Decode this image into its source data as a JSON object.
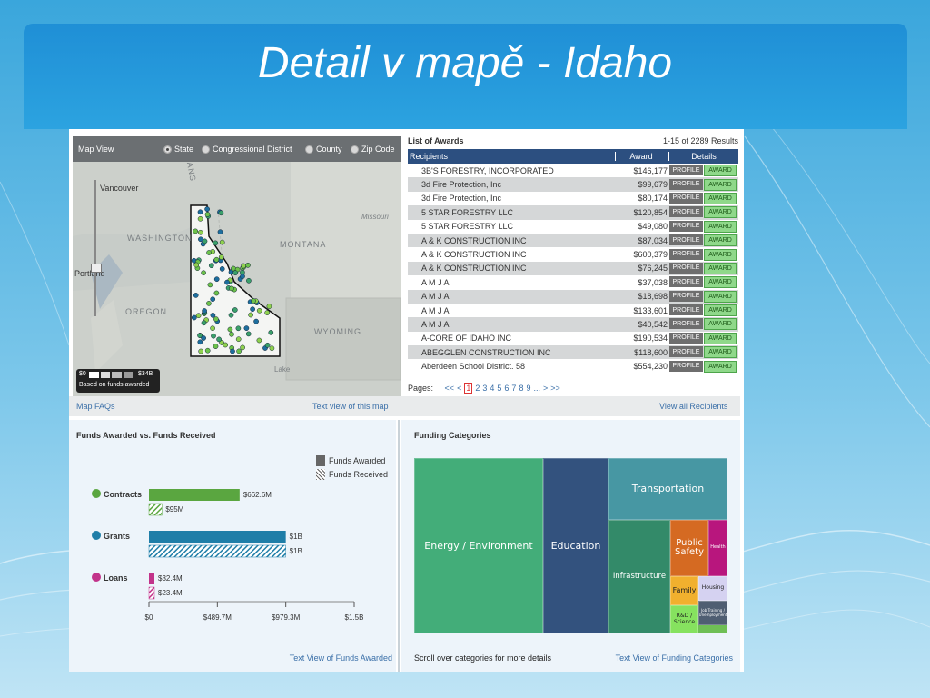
{
  "slide": {
    "title": "Detail v mapě - Idaho"
  },
  "map": {
    "header_label": "Map View",
    "view_options": [
      {
        "label": "State",
        "selected": true
      },
      {
        "label": "Congressional District",
        "selected": false
      },
      {
        "label": "County",
        "selected": false
      },
      {
        "label": "Zip Code",
        "selected": false
      }
    ],
    "place_labels": [
      "ANS",
      "Vancouver",
      "WASHINGTON",
      "Portland",
      "OREGON",
      "MONTANA",
      "WYOMING",
      "Missouri",
      "Lake"
    ],
    "legend_min": "$0",
    "legend_max": "$34B",
    "legend_caption": "Based on funds awarded",
    "faq_link": "Map FAQs",
    "text_view_link": "Text view of this map"
  },
  "awards": {
    "title": "List of Awards",
    "results": "1-15 of 2289 Results",
    "columns": [
      "Recipients",
      "Award",
      "Details"
    ],
    "profile_label": "PROFILE",
    "award_label": "AWARD",
    "rows": [
      {
        "name": "3B'S FORESTRY, INCORPORATED",
        "amount": "$146,177"
      },
      {
        "name": "3d Fire Protection, Inc",
        "amount": "$99,679"
      },
      {
        "name": "3d Fire Protection, Inc",
        "amount": "$80,174"
      },
      {
        "name": "5 STAR FORESTRY LLC",
        "amount": "$120,854"
      },
      {
        "name": "5 STAR FORESTRY LLC",
        "amount": "$49,080"
      },
      {
        "name": "A & K CONSTRUCTION INC",
        "amount": "$87,034"
      },
      {
        "name": "A & K CONSTRUCTION INC",
        "amount": "$600,379"
      },
      {
        "name": "A & K CONSTRUCTION INC",
        "amount": "$76,245"
      },
      {
        "name": "A M J A",
        "amount": "$37,038"
      },
      {
        "name": "A M J A",
        "amount": "$18,698"
      },
      {
        "name": "A M J A",
        "amount": "$133,601"
      },
      {
        "name": "A M J A",
        "amount": "$40,542"
      },
      {
        "name": "A-CORE OF IDAHO INC",
        "amount": "$190,534"
      },
      {
        "name": "ABEGGLEN CONSTRUCTION INC",
        "amount": "$118,600"
      },
      {
        "name": "Aberdeen School District. 58",
        "amount": "$554,230"
      }
    ],
    "pages_label": "Pages:",
    "pager": [
      "<<",
      "<",
      "1",
      "2",
      "3",
      "4",
      "5",
      "6",
      "7",
      "8",
      "9",
      "...",
      ">",
      ">>"
    ],
    "current_page": "1",
    "view_all_link": "View all Recipients"
  },
  "funds": {
    "title": "Funds Awarded vs. Funds Received",
    "legend_awarded": "Funds Awarded",
    "legend_received": "Funds Received",
    "text_view_link": "Text View of Funds Awarded"
  },
  "chart_data": {
    "type": "bar",
    "orientation": "horizontal",
    "title": "Funds Awarded vs. Funds Received",
    "categories": [
      "Contracts",
      "Grants",
      "Loans"
    ],
    "series": [
      {
        "name": "Funds Awarded",
        "values": [
          662.6,
          1000,
          32.4
        ],
        "labels": [
          "$662.6M",
          "$1B",
          "$32.4M"
        ]
      },
      {
        "name": "Funds Received",
        "values": [
          95,
          1000,
          23.4
        ],
        "labels": [
          "$95M",
          "$1B",
          "$23.4M"
        ]
      }
    ],
    "unit": "M",
    "xlim": [
      0,
      1500
    ],
    "xticks": [
      "$0",
      "$489.7M",
      "$979.3M",
      "$1.5B"
    ],
    "colors": {
      "Contracts": "#5aa640",
      "Grants": "#1f7ea8",
      "Loans": "#c2338a"
    }
  },
  "categories": {
    "title": "Funding Categories",
    "items": [
      {
        "label": "Energy / Environment",
        "color": "#43ad79"
      },
      {
        "label": "Education",
        "color": "#33527e"
      },
      {
        "label": "Transportation",
        "color": "#4797a3"
      },
      {
        "label": "Infrastructure",
        "color": "#338a69"
      },
      {
        "label": "Public Safety",
        "color": "#d56a22"
      },
      {
        "label": "Health",
        "color": "#b8167d"
      },
      {
        "label": "Family",
        "color": "#f1b02e"
      },
      {
        "label": "Housing",
        "color": "#d5d2f1"
      },
      {
        "label": "R&D / Science",
        "color": "#86e25f"
      },
      {
        "label": "Job Training / Unemployment",
        "color": "#4f5e72"
      }
    ],
    "hint": "Scroll over categories for more details",
    "text_view_link": "Text View of Funding Categories"
  }
}
